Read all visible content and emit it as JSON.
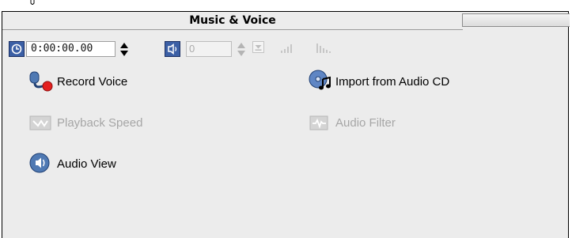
{
  "panel": {
    "title": "Music & Voice"
  },
  "toolbar": {
    "timecode": "0:00:00.00",
    "volume_value": "0"
  },
  "actions": {
    "record_voice": "Record Voice",
    "import_cd": "Import from Audio CD",
    "playback_speed": "Playback Speed",
    "audio_filter": "Audio Filter",
    "audio_view": "Audio View"
  },
  "colors": {
    "panel_bg": "#ececec",
    "icon_blue": "#3b5fa5",
    "disabled_text": "#a6a6a6"
  },
  "icons": [
    "clock-icon",
    "speaker-icon",
    "microphone-icon",
    "cd-music-icon",
    "playback-speed-icon",
    "audio-filter-icon",
    "audio-view-icon",
    "volume-meter-icon"
  ]
}
